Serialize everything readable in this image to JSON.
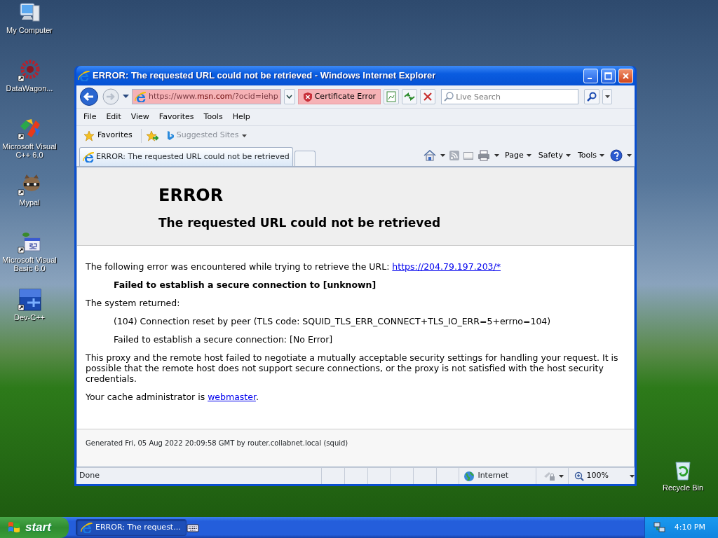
{
  "desktop_icons": [
    {
      "label": "My Computer",
      "kind": "computer",
      "shortcut": false
    },
    {
      "label": "DataWagon...",
      "kind": "gear",
      "shortcut": true
    },
    {
      "label": "Microsoft Visual C++ 6.0",
      "kind": "vcpp",
      "shortcut": true
    },
    {
      "label": "Mypal",
      "kind": "raccoon",
      "shortcut": true
    },
    {
      "label": "Microsoft Visual Basic 6.0",
      "kind": "vb",
      "shortcut": true
    },
    {
      "label": "Dev-C++",
      "kind": "dev",
      "shortcut": true
    },
    {
      "label": "Recycle Bin",
      "kind": "recycle",
      "shortcut": false
    }
  ],
  "window": {
    "title": "ERROR: The requested URL could not be retrieved - Windows Internet Explorer",
    "address": {
      "prefix": "https://www.",
      "domain": "msn.com",
      "suffix": "/?ocid=iehp"
    },
    "certificate_error": "Certificate Error",
    "search": {
      "placeholder": "Live Search"
    },
    "menu": [
      "File",
      "Edit",
      "View",
      "Favorites",
      "Tools",
      "Help"
    ],
    "favorites_bar": {
      "favorites": "Favorites",
      "suggested": "Suggested Sites"
    },
    "tabs": [
      {
        "label": "ERROR: The requested URL could not be retrieved",
        "selected": true
      }
    ],
    "command_bar": [
      "Page",
      "Safety",
      "Tools"
    ],
    "page": {
      "heading": "ERROR",
      "subheading": "The requested URL could not be retrieved",
      "body": [
        {
          "kind": "para",
          "text": "The following error was encountered while trying to retrieve the URL: ",
          "link": "https://204.79.197.203/*"
        },
        {
          "kind": "strong",
          "text": "Failed to establish a secure connection to [unknown]"
        },
        {
          "kind": "para",
          "text": "The system returned:"
        },
        {
          "kind": "indent",
          "text": "(104) Connection reset by peer (TLS code: SQUID_TLS_ERR_CONNECT+TLS_IO_ERR=5+errno=104)"
        },
        {
          "kind": "indent",
          "text": "Failed to establish a secure connection: [No Error]"
        },
        {
          "kind": "para",
          "text": "This proxy and the remote host failed to negotiate a mutually acceptable security settings for handling your request. It is possible that the remote host does not support secure connections, or the proxy is not satisfied with the host security credentials."
        },
        {
          "kind": "para",
          "text": "Your cache administrator is ",
          "link": "webmaster",
          "after": "."
        }
      ],
      "footer": "Generated Fri, 05 Aug 2022 20:09:58 GMT by router.collabnet.local (squid)"
    },
    "status_bar": {
      "text": "Done",
      "zone": "Internet",
      "zoom": "100%"
    }
  },
  "taskbar": {
    "start": "start",
    "tasks": [
      {
        "label": "ERROR: The request...",
        "selected": true
      }
    ],
    "clock": "4:10 PM"
  }
}
